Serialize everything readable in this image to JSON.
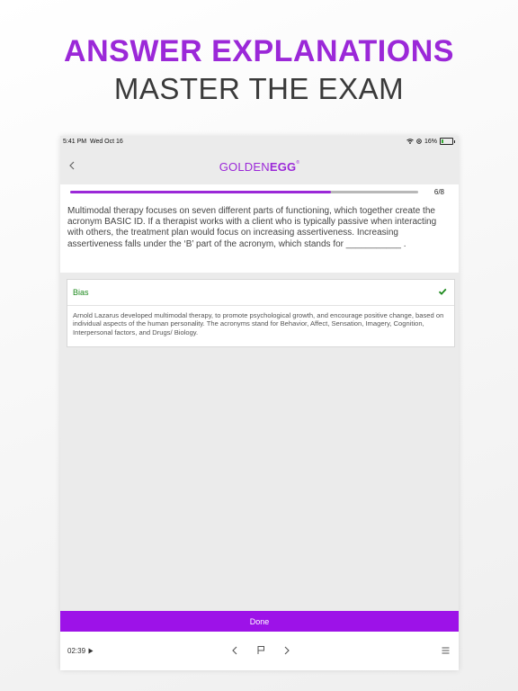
{
  "promo": {
    "headline": "ANSWER EXPLANATIONS",
    "subheadline": "MASTER THE EXAM"
  },
  "status_bar": {
    "time": "5:41 PM",
    "date": "Wed Oct 16",
    "battery": "16%"
  },
  "nav": {
    "logo_part1": "GOLDEN",
    "logo_part2": "EGG",
    "logo_mark": "®"
  },
  "progress": {
    "label": "6/8",
    "fraction": 0.75
  },
  "question": {
    "text": "Multimodal therapy focuses on seven different parts of functioning, which together create the acronym BASIC ID. If a therapist works with a client who is typically passive when interacting with others, the treatment plan would focus on increasing assertiveness. Increasing assertiveness falls under the ‘B’ part of the acronym, which stands for ___________ ."
  },
  "answer": {
    "label": "Bias",
    "explanation": "Arnold Lazarus developed multimodal therapy, to promote psychological growth, and encourage positive change, based on individual aspects of the human personality. The acronyms stand for Behavior, Affect, Sensation, Imagery, Cognition, Interpersonal factors, and Drugs/ Biology."
  },
  "footer": {
    "done_label": "Done",
    "timer": "02:39"
  },
  "colors": {
    "brand_purple": "#9b28d8",
    "done_purple": "#9d12e8",
    "correct_green": "#1e8a1e"
  },
  "icons": [
    "back-chevron-icon",
    "wifi-icon",
    "location-icon",
    "battery-icon",
    "check-icon",
    "play-icon",
    "prev-chevron-icon",
    "flag-icon",
    "next-chevron-icon",
    "menu-icon"
  ]
}
